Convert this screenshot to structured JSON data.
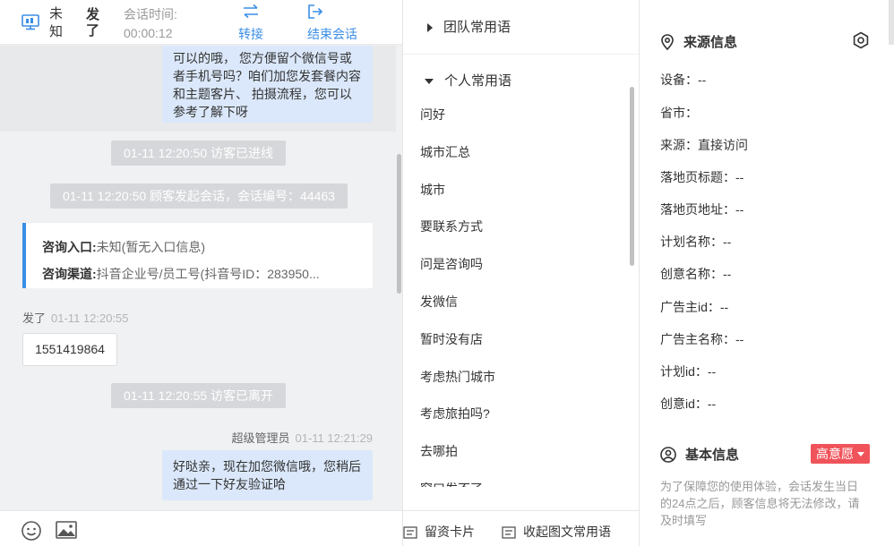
{
  "header": {
    "visitor_name_part1": "未知",
    "visitor_name_part2": "发了",
    "session_time_label": "会话时间:",
    "session_time_value": "00:00:12",
    "transfer_label": "转接",
    "end_label": "结束会话"
  },
  "messages": {
    "bubble_top": "可以的哦， 您方便留个微信号或者手机号吗？咱们加您发套餐内容和主题客片、 拍摄流程，您可以参考了解下呀",
    "sys_entered": "01-11 12:20:50 访客已进线",
    "sys_started": "01-11 12:20:50 顾客发起会话，会话编号：44463",
    "consult_entry_label": "咨询入口:",
    "consult_entry_value": "未知(暂无入口信息)",
    "consult_channel_label": "咨询渠道:",
    "consult_channel_value": "抖音企业号/员工号(抖音号ID：283950...",
    "visitor_sender": "发了",
    "visitor_time": "01-11 12:20:55",
    "visitor_phone": "1551419864",
    "sys_left": "01-11 12:20:55 访客已离开",
    "agent_sender": "超级管理员",
    "agent_time": "01-11 12:21:29",
    "bubble_agent": "好哒亲，现在加您微信哦，您稍后通过一下好友验证哈"
  },
  "phrases": {
    "team_group": "团队常用语",
    "personal_group": "个人常用语",
    "items": [
      "问好",
      "城市汇总",
      "城市",
      "要联系方式",
      "问是咨询吗",
      "发微信",
      "暂时没有店",
      "考虑热门城市",
      "考虑旅拍吗?",
      "去哪拍",
      "窗口发不了"
    ],
    "leave_card": "留资卡片",
    "collapse": "收起图文常用语"
  },
  "info": {
    "source_title": "来源信息",
    "rows": [
      "设备：--",
      "省市：",
      "来源：直接访问",
      "落地页标题：--",
      "落地页地址：--",
      "计划名称：--",
      "创意名称：--",
      "广告主id：--",
      "广告主名称：--",
      "计划id：--",
      "创意id：--"
    ],
    "basic_title": "基本信息",
    "intent_badge": "高意愿",
    "basic_note": "为了保障您的使用体验，会话发生当日的24点之后，顾客信息将无法修改，请及时填写"
  },
  "colors": {
    "accent": "#3a8ee6",
    "bubble": "#dbe8fb",
    "badge": "#f0535a"
  }
}
